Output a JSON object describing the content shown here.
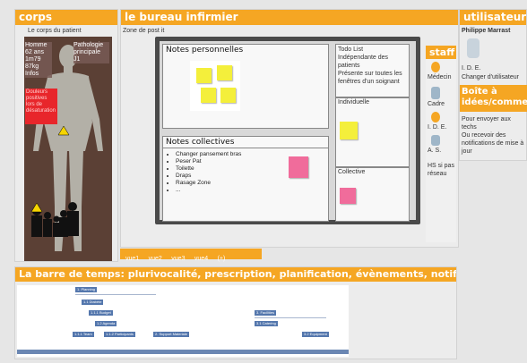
{
  "corps": {
    "title": "corps",
    "subtitle": "Le corps du patient",
    "info": [
      "Homme",
      "62 ans",
      "1m79",
      "87kg",
      "Infos"
    ],
    "patho": [
      "Pathologie",
      "principale",
      "J1"
    ],
    "alert_lines": [
      "Douleurs",
      "positives",
      "lors de",
      "désaturation"
    ]
  },
  "bureau": {
    "title": "le bureau infirmier",
    "subtitle": "Zone de post it",
    "notes_perso": "Notes personnelles",
    "notes_coll": "Notes collectives",
    "coll_items": [
      "Changer pansement bras",
      "Peser Pat",
      "Toilette",
      "Draps",
      "Rasage Zone",
      "..."
    ],
    "todo": {
      "title": "Todo List",
      "lines": [
        "Indépendante des",
        "patients",
        "Présente sur toutes les",
        "fenêtres d'un soignant"
      ]
    },
    "individuelle": "Individuelle",
    "collective": "Collective",
    "staff": {
      "title": "staff",
      "roles": [
        "Médecin",
        "Cadre",
        "I. D. E.",
        "A. S."
      ],
      "note": [
        "HS si pas",
        "réseau"
      ]
    },
    "tabs": [
      "vue1",
      "vue2",
      "vue3",
      "vue4",
      "(+)"
    ]
  },
  "user": {
    "title": "utilisateur",
    "name": "Philippe Marrast",
    "role": "I. D. E.",
    "link": "Changer d'utilisateur",
    "box_title": [
      "Boîte à",
      "idées/commentaires"
    ],
    "box_text": [
      "Pour envoyer aux",
      "techs",
      "Ou recevoir des",
      "notifications de mise à",
      "jour"
    ]
  },
  "timeline": {
    "title": "La barre de temps: plurivocalité, prescription, planification, évènements, notifications",
    "labels": [
      "1. Planning",
      "1.1 Diabète",
      "1.1.1 Budget",
      "1.2 Agenda",
      "1.1.1 Team",
      "1.1.2 Participants",
      "2. Support Materiale",
      "3. Facilities",
      "3.1 Catering",
      "3.2 Equipment"
    ]
  }
}
